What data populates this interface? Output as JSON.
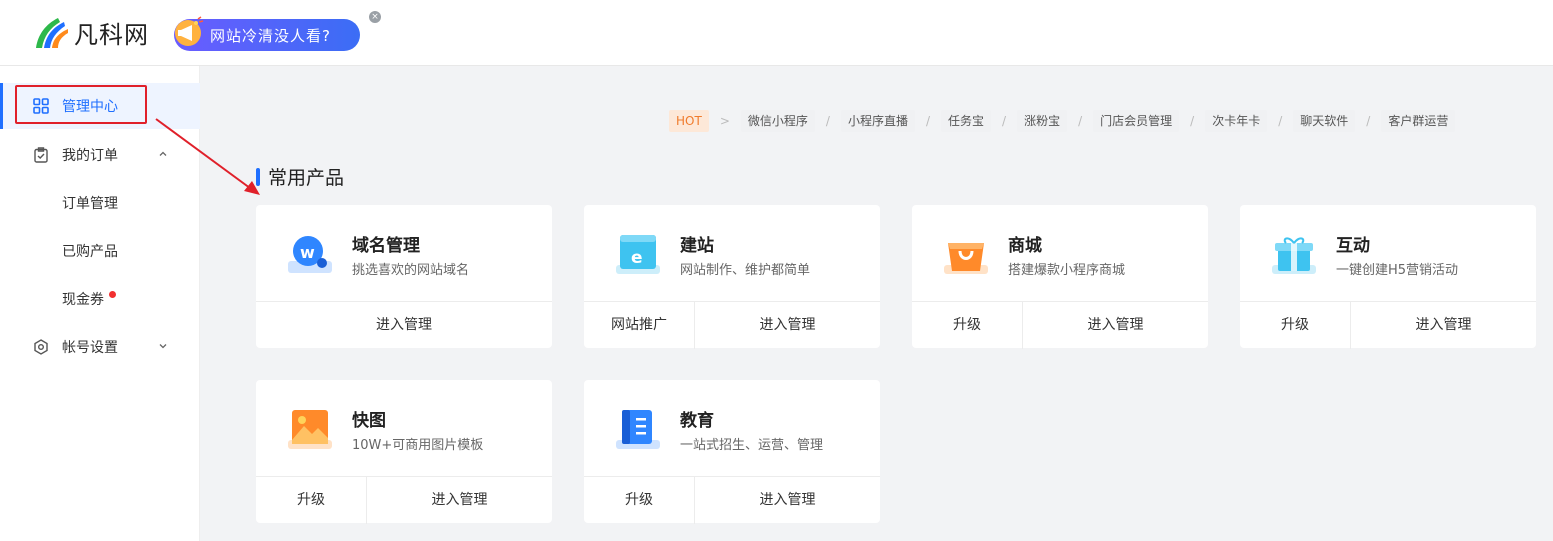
{
  "header": {
    "logo_text": "凡科网",
    "promo_text": "网站冷清没人看?",
    "promo_close": "×"
  },
  "sidebar": {
    "items": [
      {
        "label": "管理中心",
        "icon": "grid-icon",
        "active": true
      },
      {
        "label": "我的订单",
        "icon": "clipboard-check-icon",
        "expanded": true
      },
      {
        "label": "订单管理"
      },
      {
        "label": "已购产品"
      },
      {
        "label": "现金券",
        "badge_dot": true
      },
      {
        "label": "帐号设置",
        "icon": "settings-hexagon-icon",
        "expanded": false
      }
    ]
  },
  "hot": {
    "label": "HOT",
    "arrow": ">",
    "separator": "/",
    "tags": [
      "微信小程序",
      "小程序直播",
      "任务宝",
      "涨粉宝",
      "门店会员管理",
      "次卡年卡",
      "聊天软件",
      "客户群运营"
    ]
  },
  "section": {
    "title": "常用产品"
  },
  "products": [
    {
      "name": "域名管理",
      "desc": "挑选喜欢的网站域名",
      "icon": "domain-w-icon",
      "actions": [
        "进入管理"
      ]
    },
    {
      "name": "建站",
      "desc": "网站制作、维护都简单",
      "icon": "website-e-icon",
      "actions": [
        "网站推广",
        "进入管理"
      ]
    },
    {
      "name": "商城",
      "desc": "搭建爆款小程序商城",
      "icon": "shopping-bag-icon",
      "actions": [
        "升级",
        "进入管理"
      ]
    },
    {
      "name": "互动",
      "desc": "一键创建H5营销活动",
      "icon": "gift-icon",
      "actions": [
        "升级",
        "进入管理"
      ]
    },
    {
      "name": "快图",
      "desc": "10W+可商用图片模板",
      "icon": "image-icon",
      "actions": [
        "升级",
        "进入管理"
      ]
    },
    {
      "name": "教育",
      "desc": "一站式招生、运营、管理",
      "icon": "book-icon",
      "actions": [
        "升级",
        "进入管理"
      ]
    }
  ],
  "colors": {
    "accent": "#1f6fff",
    "highlight": "#e0202a",
    "hot": "#f07b2c"
  }
}
